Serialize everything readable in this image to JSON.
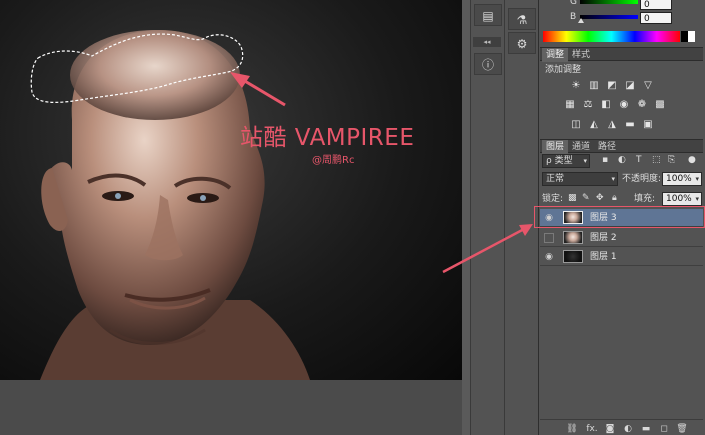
{
  "canvas": {
    "watermark_title": "站酷 VAMPIREE",
    "watermark_author": "@周鹏Rc",
    "accent_color": "#e7566a"
  },
  "dock": {
    "history_icon": "history-icon",
    "tool_presets_icon": "tool-presets-icon",
    "adjust_icon": "sliders-icon",
    "info_icon": "info-icon",
    "collapse_label": "◂◂"
  },
  "color_panel": {
    "g_label": "G",
    "g_value": "0",
    "b_label": "B",
    "b_value": "0"
  },
  "adjustments_panel": {
    "tabs": [
      {
        "label": "调整",
        "active": true
      },
      {
        "label": "样式",
        "active": false
      }
    ],
    "title": "添加调整"
  },
  "layers_panel": {
    "tabs": [
      {
        "label": "图层",
        "active": true
      },
      {
        "label": "通道",
        "active": false
      },
      {
        "label": "路径",
        "active": false
      }
    ],
    "filter_label": "ρ 类型",
    "blend_mode": "正常",
    "opacity_label": "不透明度:",
    "opacity_value": "100%",
    "lock_label": "锁定:",
    "fill_label": "填充:",
    "fill_value": "100%",
    "layers": [
      {
        "name": "图层 3",
        "visible": true,
        "selected": true
      },
      {
        "name": "图层 2",
        "visible": false,
        "selected": false
      },
      {
        "name": "图层 1",
        "visible": true,
        "selected": false
      }
    ],
    "footer_fx": "fx."
  }
}
